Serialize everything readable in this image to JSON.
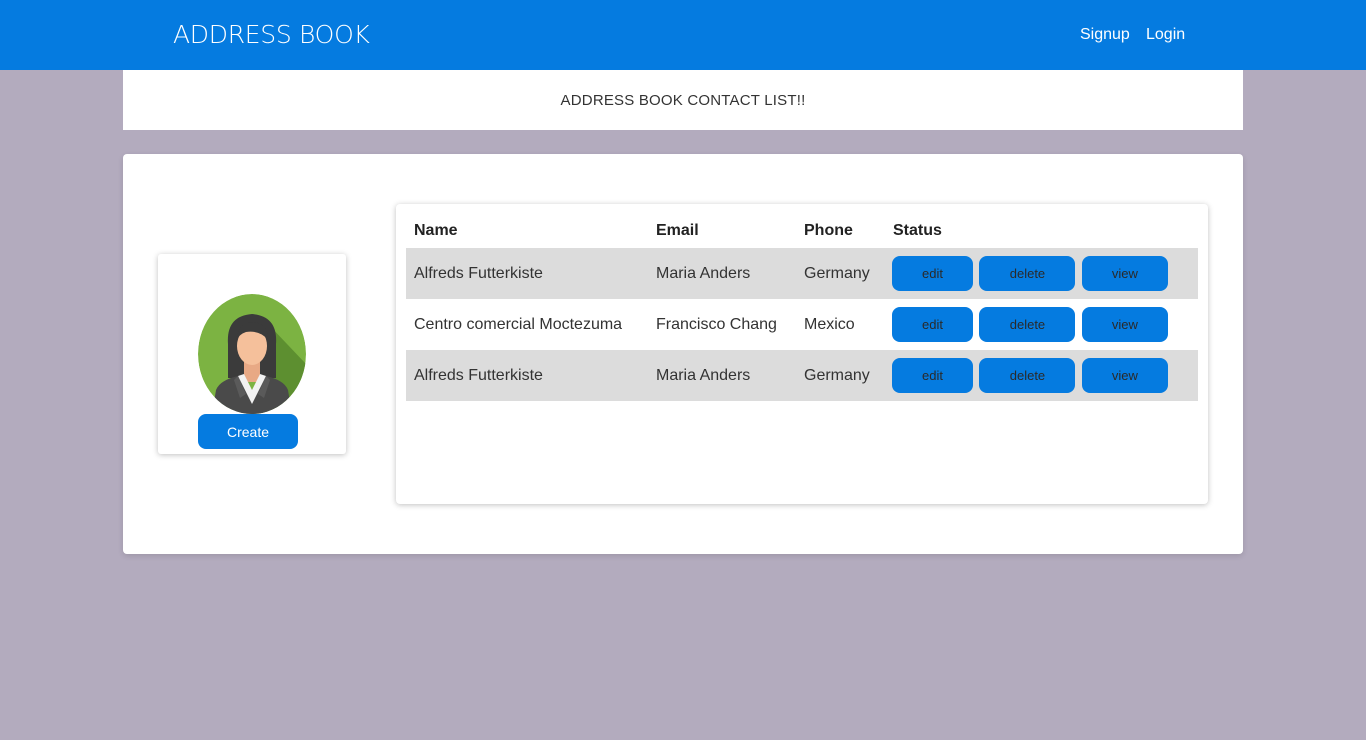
{
  "navbar": {
    "brand": "ADDRESS BOOK",
    "links": [
      {
        "label": "Signup"
      },
      {
        "label": "Login"
      }
    ]
  },
  "subheader": {
    "title": "ADDRESS BOOK CONTACT LIST!!"
  },
  "profile": {
    "create_label": "Create"
  },
  "table": {
    "headers": [
      "Name",
      "Email",
      "Phone",
      "Status"
    ],
    "rows": [
      {
        "name": "Alfreds Futterkiste",
        "email": "Maria Anders",
        "phone": "Germany"
      },
      {
        "name": "Centro comercial Moctezuma",
        "email": "Francisco Chang",
        "phone": "Mexico"
      },
      {
        "name": "Alfreds Futterkiste",
        "email": "Maria Anders",
        "phone": "Germany"
      }
    ],
    "actions": {
      "edit": "edit",
      "delete": "delete",
      "view": "view"
    }
  },
  "colors": {
    "primary": "#057be0",
    "background": "#b3abbe",
    "row_shade": "#dcdcdc"
  },
  "icons": {
    "avatar": "businesswoman-avatar-icon"
  }
}
